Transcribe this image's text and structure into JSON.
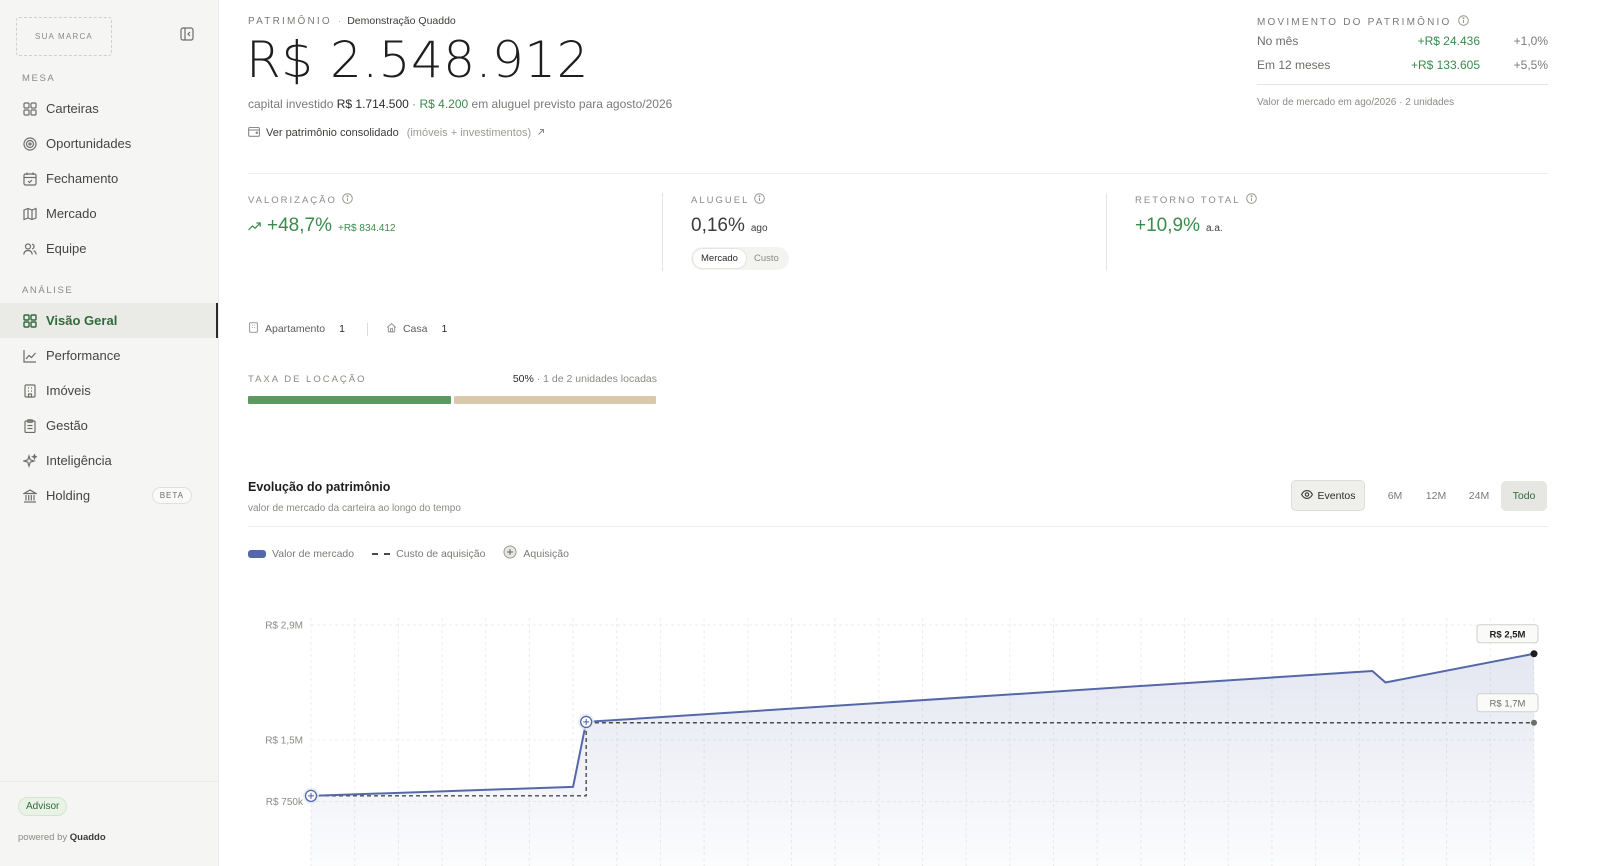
{
  "sidebar": {
    "brand": "SUA MARCA",
    "sections": [
      {
        "label": "MESA",
        "items": [
          {
            "label": "Carteiras",
            "icon": "grid-icon"
          },
          {
            "label": "Oportunidades",
            "icon": "target-icon"
          },
          {
            "label": "Fechamento",
            "icon": "calendar-icon"
          },
          {
            "label": "Mercado",
            "icon": "map-icon"
          },
          {
            "label": "Equipe",
            "icon": "users-icon"
          }
        ]
      },
      {
        "label": "ANÁLISE",
        "items": [
          {
            "label": "Visão Geral",
            "icon": "grid-icon",
            "active": true
          },
          {
            "label": "Performance",
            "icon": "line-chart-icon"
          },
          {
            "label": "Imóveis",
            "icon": "building-icon"
          },
          {
            "label": "Gestão",
            "icon": "clipboard-icon"
          },
          {
            "label": "Inteligência",
            "icon": "sparkles-icon"
          },
          {
            "label": "Holding",
            "icon": "bank-icon",
            "badge": "BETA"
          }
        ]
      }
    ],
    "footer": {
      "badge": "Advisor",
      "powered_prefix": "powered by",
      "powered_brand": "Quaddo"
    }
  },
  "header": {
    "eyebrow": "PATRIMÔNIO",
    "eyebrow_sep": "·",
    "eyebrow_sub": "Demonstração Quaddo",
    "total": "R$ 2.548.912",
    "line_prefix": "capital investido",
    "capital": "R$ 1.714.500",
    "line_sep": " · ",
    "rent": "R$ 4.200",
    "line_suffix": "em aluguel previsto para agosto/2026",
    "consolidated_link": "Ver patrimônio consolidado",
    "consolidated_note": "(imóveis + investimentos)"
  },
  "movement": {
    "title": "MOVIMENTO DO PATRIMÔNIO",
    "rows": [
      {
        "label": "No mês",
        "value": "+R$ 24.436",
        "pct": "+1,0%"
      },
      {
        "label": "Em 12 meses",
        "value": "+R$ 133.605",
        "pct": "+5,5%"
      }
    ],
    "note": "Valor de mercado em ago/2026 · 2 unidades"
  },
  "kpis": {
    "valorizacao": {
      "label": "VALORIZAÇÃO",
      "value": "+48,7%",
      "delta": "+R$ 834.412"
    },
    "aluguel": {
      "label": "ALUGUEL",
      "value": "0,16%",
      "suffix": "ago",
      "toggle": [
        "Mercado",
        "Custo"
      ],
      "toggle_selected": "Mercado"
    },
    "retorno": {
      "label": "RETORNO TOTAL",
      "value": "+10,9%",
      "suffix": "a.a."
    }
  },
  "property_types": [
    {
      "label": "Apartamento",
      "count": "1"
    },
    {
      "label": "Casa",
      "count": "1"
    }
  ],
  "occupancy": {
    "label": "TAXA DE LOCAÇÃO",
    "pct": "50%",
    "detail": " · 1 de 2 unidades locadas",
    "rate": 0.5,
    "colors": {
      "leased": "#5a9a62",
      "vacant": "#d8c9ab"
    }
  },
  "chart_header": {
    "title": "Evolução do patrimônio",
    "subtitle": "valor de mercado da carteira ao longo do tempo",
    "events_button": "Eventos",
    "ranges": [
      "6M",
      "12M",
      "24M",
      "Todo"
    ],
    "selected_range": "Todo"
  },
  "legend": {
    "market": "Valor de mercado",
    "cost": "Custo de aquisição",
    "acquisition": "Aquisição"
  },
  "chart_data": {
    "type": "line",
    "yticks": [
      "R$ 2,9M",
      "R$ 1,5M",
      "R$ 750k"
    ],
    "ytick_values": [
      2.9,
      1.5,
      0.75
    ],
    "x_count": 28,
    "series": [
      {
        "name": "Valor de mercado",
        "color": "#5468a8",
        "points": [
          [
            0,
            0.82
          ],
          [
            6,
            0.93
          ],
          [
            6.3,
            1.72
          ],
          [
            24.3,
            2.34
          ],
          [
            24.6,
            2.2
          ],
          [
            28,
            2.55
          ]
        ]
      },
      {
        "name": "Custo de aquisição",
        "color": "#4a4a48",
        "points": [
          [
            0,
            0.82
          ],
          [
            6.3,
            0.82
          ],
          [
            6.3,
            1.71
          ],
          [
            28,
            1.71
          ]
        ]
      }
    ],
    "acquisitions": [
      [
        0,
        0.82
      ],
      [
        6.3,
        1.72
      ]
    ],
    "end_labels": {
      "market": "R$ 2,5M",
      "cost": "R$ 1,7M"
    }
  }
}
